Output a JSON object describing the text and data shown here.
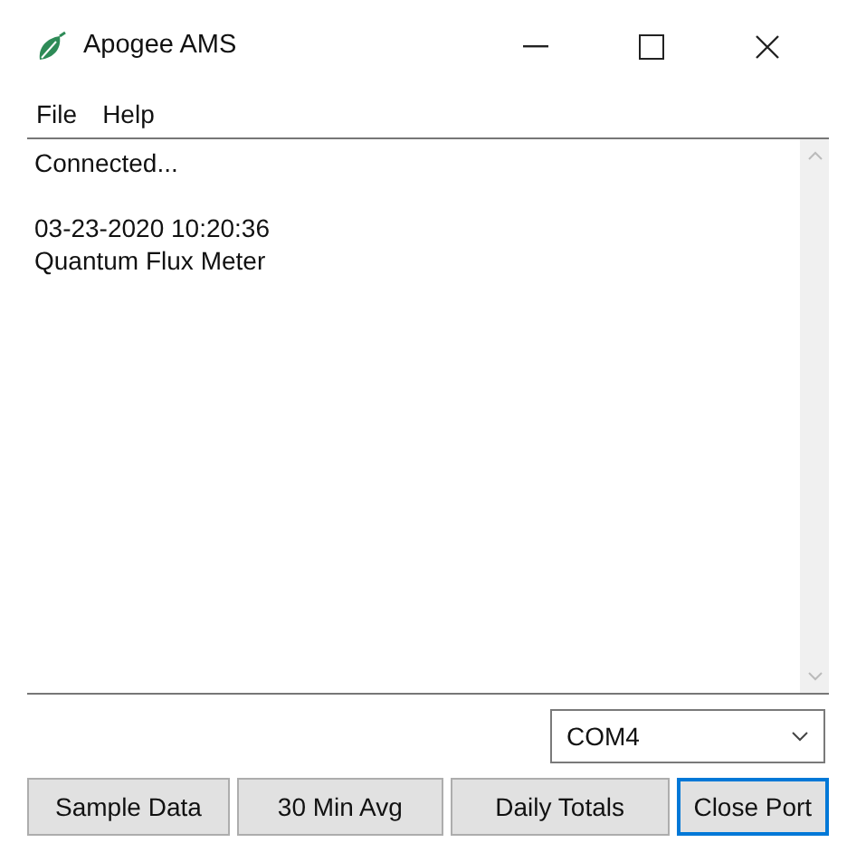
{
  "window": {
    "title": "Apogee AMS"
  },
  "menu": [
    "File",
    "Help"
  ],
  "output": {
    "blocks": [
      [
        "Connected..."
      ],
      [
        "03-23-2020 10:20:36",
        "Quantum Flux Meter"
      ]
    ]
  },
  "port_select": {
    "value": "COM4"
  },
  "buttons": [
    {
      "label": "Sample Data",
      "focused": false
    },
    {
      "label": "30 Min Avg",
      "focused": false
    },
    {
      "label": "Daily Totals",
      "focused": false
    },
    {
      "label": "Close Port",
      "focused": true
    }
  ]
}
